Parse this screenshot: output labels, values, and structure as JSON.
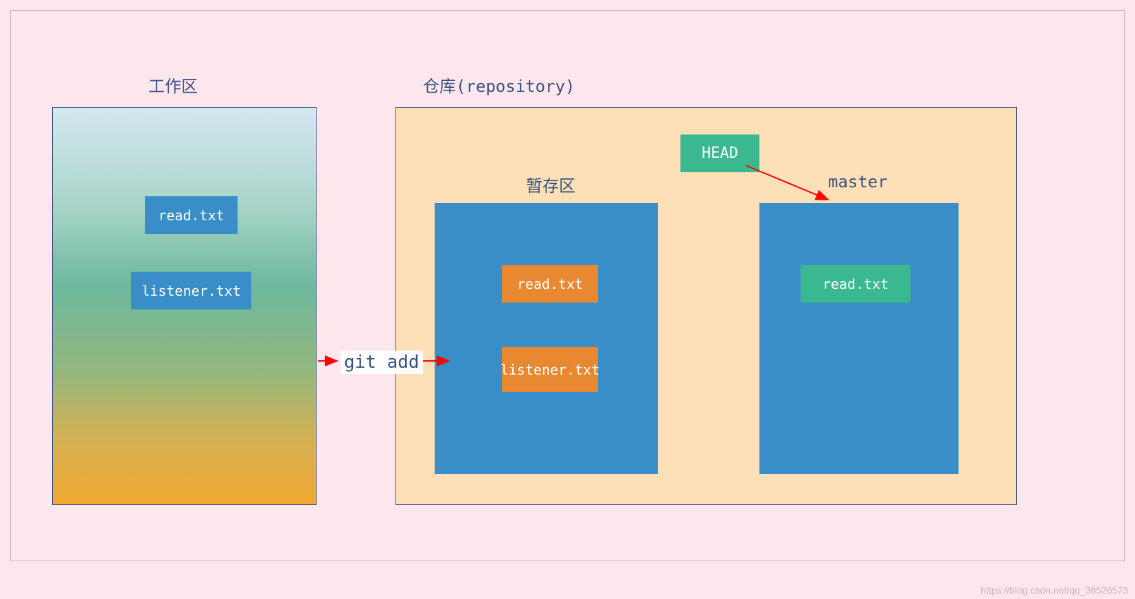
{
  "labels": {
    "working_area": "工作区",
    "repository": "仓库(repository)",
    "staging_area": "暂存区",
    "master": "master",
    "head": "HEAD",
    "git_add": "git add"
  },
  "working_area_files": {
    "file1": "read.txt",
    "file2": "listener.txt"
  },
  "staging_area_files": {
    "file1": "read.txt",
    "file2": "listener.txt"
  },
  "master_files": {
    "file1": "read.txt"
  },
  "watermark": "https://blog.csdn.net/qq_38526573"
}
